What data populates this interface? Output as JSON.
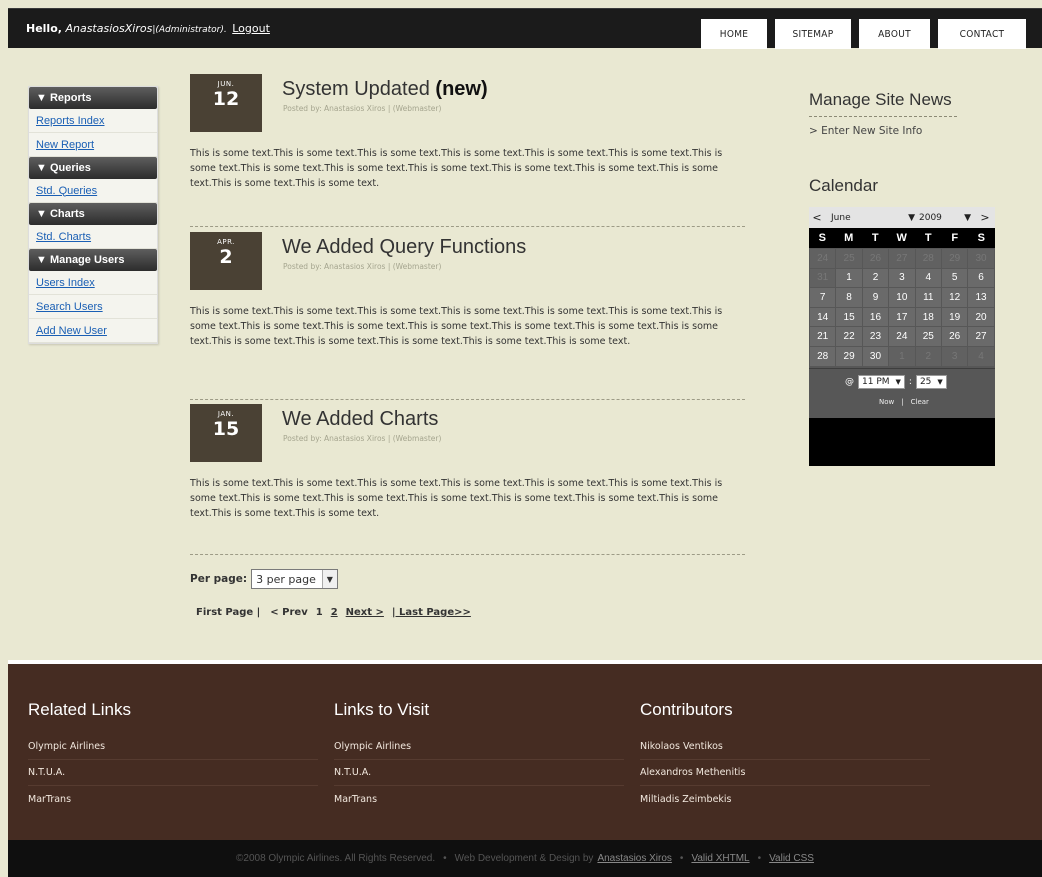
{
  "header": {
    "hello": "Hello,",
    "user": "AnastasiosXiros",
    "role": "|(Administrator).",
    "logout": "Logout",
    "nav": [
      "HOME",
      "SITEMAP",
      "ABOUT",
      "CONTACT"
    ]
  },
  "menu": [
    {
      "head": "▼ Reports",
      "links": [
        "Reports Index",
        "New Report"
      ]
    },
    {
      "head": "▼ Queries",
      "links": [
        "Std. Queries"
      ]
    },
    {
      "head": "▼ Charts",
      "links": [
        "Std. Charts"
      ]
    },
    {
      "head": "▼ Manage Users",
      "links": [
        "Users Index",
        "Search Users",
        "Add New User"
      ]
    }
  ],
  "posts": [
    {
      "month": "JUN.",
      "day": "12",
      "title": "System Updated",
      "title_bold": "(new)",
      "by": "Posted by: Anastasios Xiros | (Webmaster)",
      "body": "This is some text.This is some text.This is some text.This is some text.This is some text.This is some text.This is some text.This is some text.This is some text.This is some text.This is some text.This is some text.This is some text.This is some text.This is some text."
    },
    {
      "month": "APR.",
      "day": "2",
      "title": "We Added Query Functions",
      "title_bold": "",
      "by": "Posted by: Anastasios Xiros | (Webmaster)",
      "body": "This is some text.This is some text.This is some text.This is some text.This is some text.This is some text.This is some text.This is some text.This is some text.This is some text.This is some text.This is some text.This is some text.This is some text.This is some text.This is some text.This is some text.This is some text."
    },
    {
      "month": "JAN.",
      "day": "15",
      "title": "We Added Charts",
      "title_bold": "",
      "by": "Posted by: Anastasios Xiros | (Webmaster)",
      "body": "This is some text.This is some text.This is some text.This is some text.This is some text.This is some text.This is some text.This is some text.This is some text.This is some text.This is some text.This is some text.This is some text.This is some text.This is some text."
    }
  ],
  "pager": {
    "per_page_label": "Per page:",
    "per_page_value": "3 per page",
    "first": "First Page |",
    "prev": "< Prev",
    "page1": "1",
    "page2": "2",
    "next": "Next >",
    "last": "| Last Page>>"
  },
  "sidebar": {
    "news_title": "Manage Site News",
    "news_link": "> Enter New Site Info",
    "calendar_title": "Calendar"
  },
  "calendar": {
    "prev": "<",
    "next": ">",
    "month": "June",
    "year": "2009",
    "dow": [
      "S",
      "M",
      "T",
      "W",
      "T",
      "F",
      "S"
    ],
    "weeks": [
      [
        "24",
        "25",
        "26",
        "27",
        "28",
        "29",
        "30"
      ],
      [
        "31",
        "1",
        "2",
        "3",
        "4",
        "5",
        "6"
      ],
      [
        "7",
        "8",
        "9",
        "10",
        "11",
        "12",
        "13"
      ],
      [
        "14",
        "15",
        "16",
        "17",
        "18",
        "19",
        "20"
      ],
      [
        "21",
        "22",
        "23",
        "24",
        "25",
        "26",
        "27"
      ],
      [
        "28",
        "29",
        "30",
        "1",
        "2",
        "3",
        "4"
      ]
    ],
    "at": "@",
    "hour": "11 PM",
    "colon": ":",
    "minute": "25",
    "now": "Now",
    "sep": "|",
    "clear": "Clear"
  },
  "footer": {
    "cols": [
      {
        "title": "Related Links",
        "links": [
          "Olympic Airlines",
          "N.T.U.A.",
          "MarTrans"
        ]
      },
      {
        "title": "Links to Visit",
        "links": [
          "Olympic Airlines",
          "N.T.U.A.",
          "MarTrans"
        ]
      },
      {
        "title": "Contributors",
        "links": [
          "Nikolaos Ventikos",
          "Alexandros Methenitis",
          "Miltiadis Zeimbekis"
        ]
      }
    ],
    "copyright": "©2008 Olympic Airlines. All Rights Reserved.",
    "design_by": "Web Development & Design by",
    "designer": "Anastasios Xiros",
    "xhtml": "Valid XHTML",
    "css": "Valid CSS",
    "bullet": "•"
  }
}
